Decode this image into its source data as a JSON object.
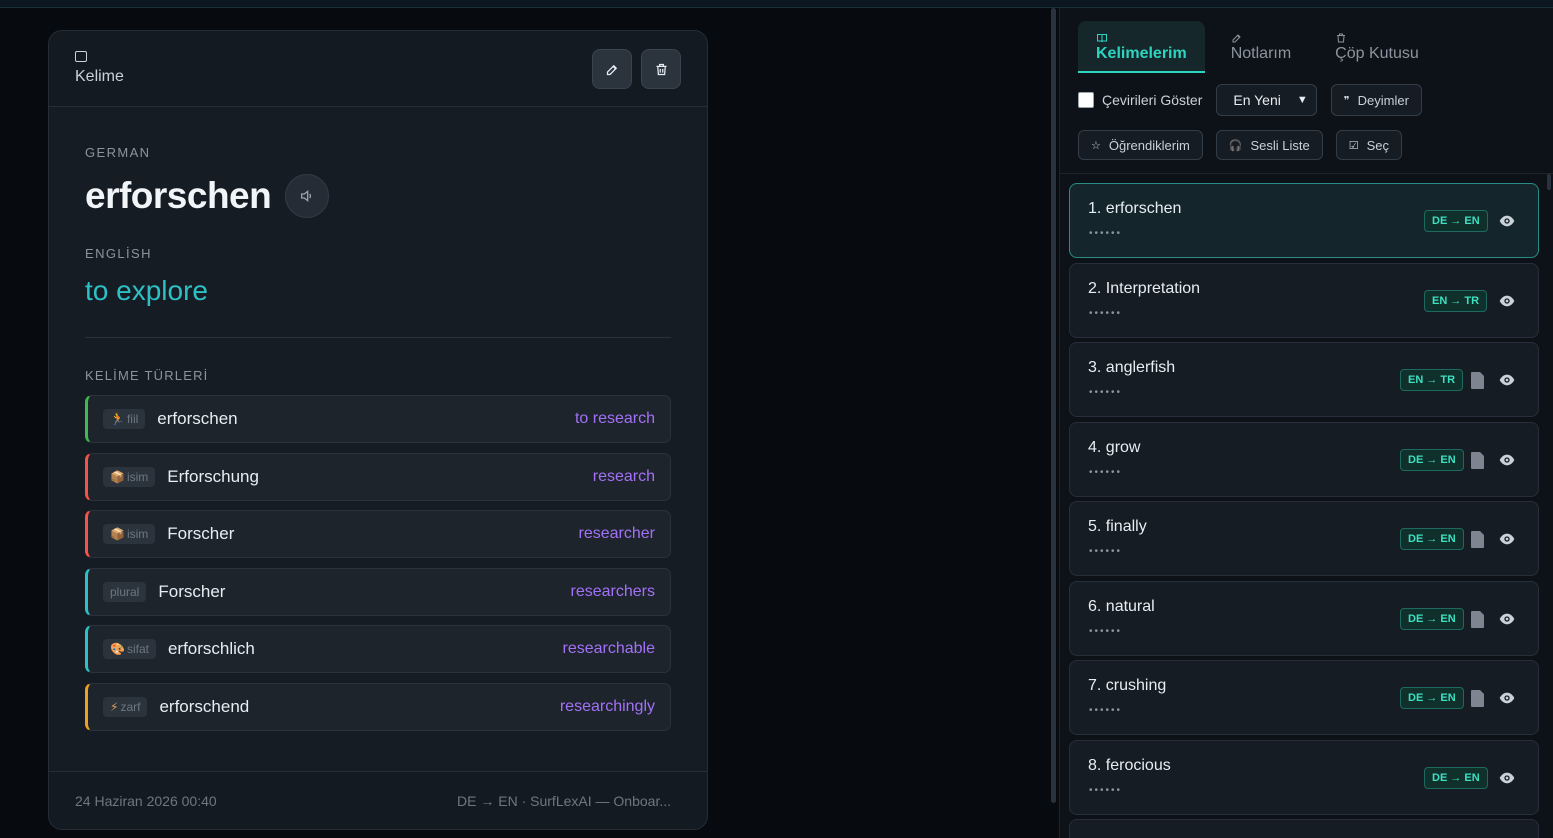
{
  "card": {
    "header_title": "Kelime",
    "source_lang": "GERMAN",
    "word": "erforschen",
    "target_lang": "ENGLİSH",
    "translation": "to explore",
    "types_label": "KELİME TÜRLERİ",
    "types": [
      {
        "emoji": "🏃",
        "tag": "fiil",
        "word": "erforschen",
        "translation": "to research",
        "color": "#3fb950"
      },
      {
        "emoji": "📦",
        "tag": "isim",
        "word": "Erforschung",
        "translation": "research",
        "color": "#f85149"
      },
      {
        "emoji": "📦",
        "tag": "isim",
        "word": "Forscher",
        "translation": "researcher",
        "color": "#f85149"
      },
      {
        "emoji": "",
        "tag": "plural",
        "word": "Forscher",
        "translation": "researchers",
        "color": "#2dc0c4"
      },
      {
        "emoji": "🎨",
        "tag": "sifat",
        "word": "erforschlich",
        "translation": "researchable",
        "color": "#2dc0c4"
      },
      {
        "emoji": "⚡",
        "tag": "zarf",
        "word": "erforschend",
        "translation": "researchingly",
        "color": "#f0a020"
      }
    ],
    "footer_date": "24 Haziran 2026 00:40",
    "footer_source": "DE → EN · SurfLexAI — Onboar..."
  },
  "panel": {
    "tabs": [
      {
        "label": "Kelimelerim",
        "icon": "book-icon",
        "active": true
      },
      {
        "label": "Notlarım",
        "icon": "edit-icon",
        "active": false
      },
      {
        "label": "Çöp Kutusu",
        "icon": "trash-icon",
        "active": false
      }
    ],
    "show_translations_label": "Çevirileri Göster",
    "sort_selected": "En Yeni",
    "idioms_label": "Deyimler",
    "learned_label": "Öğrendiklerim",
    "audio_list_label": "Sesli Liste",
    "select_label": "Seç",
    "masked_text": "••••••",
    "words": [
      {
        "title": "1. erforschen",
        "badge": "DE → EN",
        "has_note": false,
        "selected": true
      },
      {
        "title": "2. Interpretation",
        "badge": "EN → TR",
        "has_note": false,
        "selected": false
      },
      {
        "title": "3. anglerfish",
        "badge": "EN → TR",
        "has_note": true,
        "selected": false
      },
      {
        "title": "4. grow",
        "badge": "DE → EN",
        "has_note": true,
        "selected": false
      },
      {
        "title": "5. finally",
        "badge": "DE → EN",
        "has_note": true,
        "selected": false
      },
      {
        "title": "6. natural",
        "badge": "DE → EN",
        "has_note": true,
        "selected": false
      },
      {
        "title": "7. crushing",
        "badge": "DE → EN",
        "has_note": true,
        "selected": false
      },
      {
        "title": "8. ferocious",
        "badge": "DE → EN",
        "has_note": false,
        "selected": false
      }
    ]
  }
}
